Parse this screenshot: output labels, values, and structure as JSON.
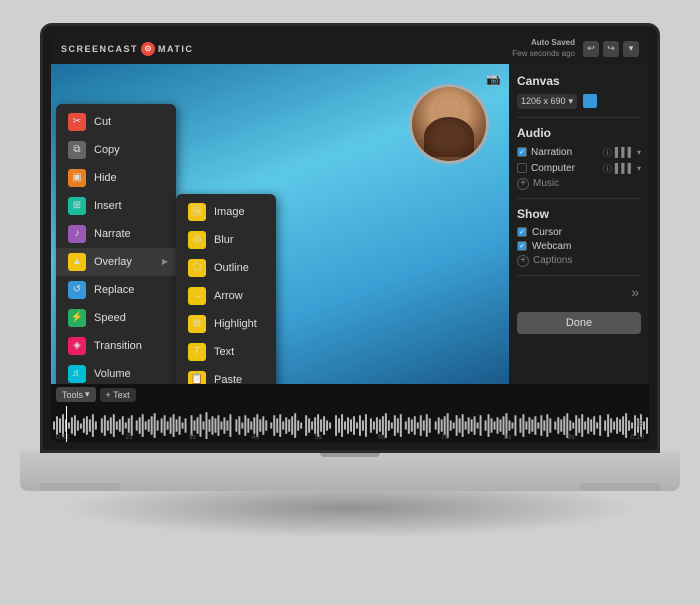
{
  "app": {
    "name_left": "SCREENCAST",
    "name_right": "MATIC",
    "logo_symbol": "⊙",
    "auto_saved_title": "Auto Saved",
    "auto_saved_sub": "Few seconds ago"
  },
  "toolbar": {
    "undo_icon": "↩",
    "redo_icon": "↪",
    "dropdown_icon": "▾"
  },
  "context_menu": {
    "items": [
      {
        "id": "cut",
        "label": "Cut",
        "icon": "✂",
        "icon_class": "icon-red"
      },
      {
        "id": "copy",
        "label": "Copy",
        "icon": "⧉",
        "icon_class": "icon-gray"
      },
      {
        "id": "hide",
        "label": "Hide",
        "icon": "▣",
        "icon_class": "icon-orange"
      },
      {
        "id": "insert",
        "label": "Insert",
        "icon": "⊞",
        "icon_class": "icon-teal"
      },
      {
        "id": "narrate",
        "label": "Narrate",
        "icon": "♪",
        "icon_class": "icon-purple"
      },
      {
        "id": "overlay",
        "label": "Overlay",
        "icon": "▲",
        "icon_class": "icon-yellow",
        "has_submenu": true
      },
      {
        "id": "replace",
        "label": "Replace",
        "icon": "↺",
        "icon_class": "icon-blue"
      },
      {
        "id": "speed",
        "label": "Speed",
        "icon": "⚡",
        "icon_class": "icon-green"
      },
      {
        "id": "transition",
        "label": "Transition",
        "icon": "◈",
        "icon_class": "icon-pink"
      },
      {
        "id": "volume",
        "label": "Volume",
        "icon": "♬",
        "icon_class": "icon-cyan"
      }
    ]
  },
  "submenu": {
    "items": [
      {
        "id": "image",
        "label": "Image",
        "icon": "🖼",
        "icon_class": "icon-yellow"
      },
      {
        "id": "blur",
        "label": "Blur",
        "icon": "◎",
        "icon_class": "icon-yellow"
      },
      {
        "id": "outline",
        "label": "Outline",
        "icon": "⬡",
        "icon_class": "icon-yellow"
      },
      {
        "id": "arrow",
        "label": "Arrow",
        "icon": "→",
        "icon_class": "icon-yellow"
      },
      {
        "id": "highlight",
        "label": "Highlight",
        "icon": "⊞",
        "icon_class": "icon-yellow"
      },
      {
        "id": "text",
        "label": "Text",
        "icon": "T",
        "icon_class": "icon-yellow"
      },
      {
        "id": "paste",
        "label": "Paste",
        "icon": "📋",
        "icon_class": "icon-yellow"
      }
    ]
  },
  "right_panel": {
    "canvas_title": "Canvas",
    "canvas_size": "1206 x 690",
    "canvas_dropdown": "▾",
    "audio_title": "Audio",
    "narration_label": "Narration",
    "computer_label": "Computer",
    "music_label": "Music",
    "show_title": "Show",
    "cursor_label": "Cursor",
    "webcam_label": "Webcam",
    "captions_label": "Captions",
    "done_label": "Done",
    "check": "✓",
    "plus": "+"
  },
  "timeline": {
    "tools_label": "Tools",
    "tools_dropdown": "▾",
    "text_plus": "+ Text",
    "time_labels": [
      "0:01",
      "2s",
      "3s",
      "4s",
      "5s",
      "6s",
      "7s",
      "8s",
      "9s",
      "0:10"
    ],
    "search_icon": "⊕"
  }
}
